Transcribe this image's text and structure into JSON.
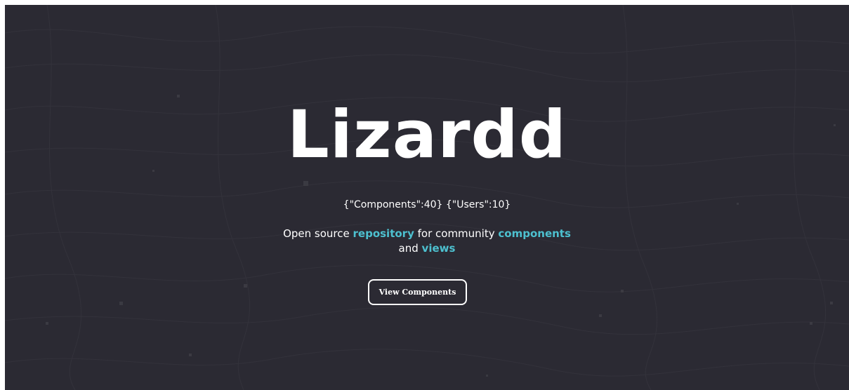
{
  "hero": {
    "title": "Lizardd",
    "stats": "{\"Components\":40} {\"Users\":10}",
    "tagline": {
      "part1": "Open source ",
      "word1": "repository",
      "part2": " for community ",
      "word2": "components",
      "part3": "and ",
      "word3": "views"
    },
    "button_label": "View Components"
  },
  "colors": {
    "background": "#2b2a33",
    "accent": "#4dc0cf",
    "text": "#ffffff"
  }
}
